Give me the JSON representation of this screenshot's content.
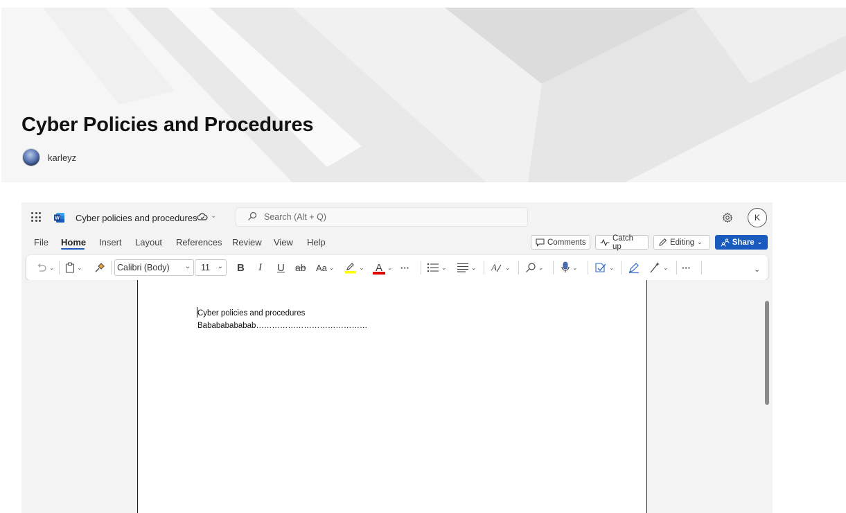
{
  "hero": {
    "title": "Cyber Policies and Procedures",
    "author": "karleyz"
  },
  "word": {
    "document_name": "Cyber policies and procedures",
    "search_placeholder": "Search (Alt + Q)",
    "user_initial": "K",
    "menu_tabs": [
      "File",
      "Home",
      "Insert",
      "Layout",
      "References",
      "Review",
      "View",
      "Help"
    ],
    "active_tab": "Home",
    "actions": {
      "comments": "Comments",
      "catch_up": "Catch up",
      "editing": "Editing",
      "share": "Share"
    },
    "ribbon": {
      "font_name": "Calibri (Body)",
      "font_size": "11",
      "bold": "B",
      "italic": "I",
      "underline": "U",
      "strike": "ab",
      "change_case": "Aa",
      "font_color": "A",
      "more": "···",
      "highlight_color": "#ffff00",
      "font_color_bar": "#e00000"
    },
    "document": {
      "line1": "Cyber policies and procedures",
      "line2": "Babababababab……………………………………"
    },
    "accent_color": "#185abd"
  }
}
